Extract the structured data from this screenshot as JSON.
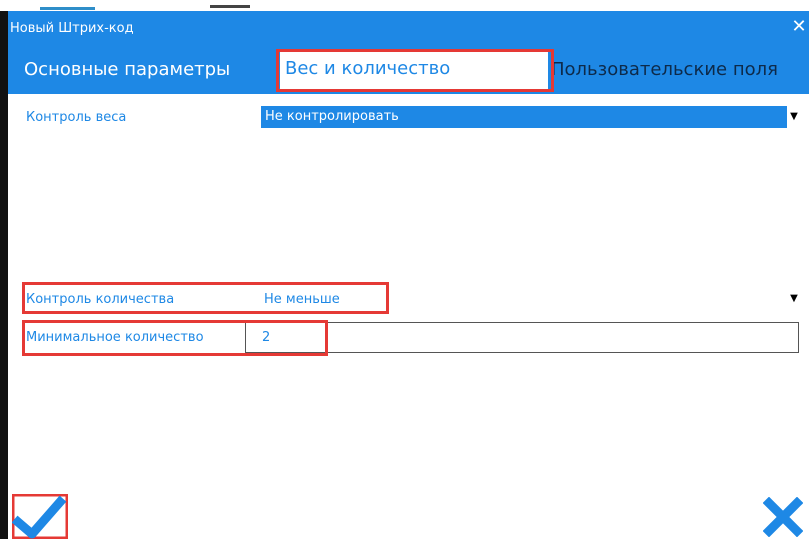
{
  "dialog": {
    "title": "Новый Штрих-код"
  },
  "tabs": {
    "main": "Основные параметры",
    "weight_quantity": "Вес и количество",
    "custom_fields": "Пользовательские поля"
  },
  "weight_control": {
    "label": "Контроль веса",
    "value": "Не контролировать"
  },
  "quantity_control": {
    "label": "Контроль количества",
    "value": "Не меньше"
  },
  "min_quantity": {
    "label": "Минимальное количество",
    "value": "2"
  },
  "icons": {
    "ok": "checkmark-icon",
    "cancel": "close-icon"
  },
  "colors": {
    "accent": "#1e88e5",
    "highlight": "#e53935",
    "dark_tab_text": "#0d2a4a"
  }
}
